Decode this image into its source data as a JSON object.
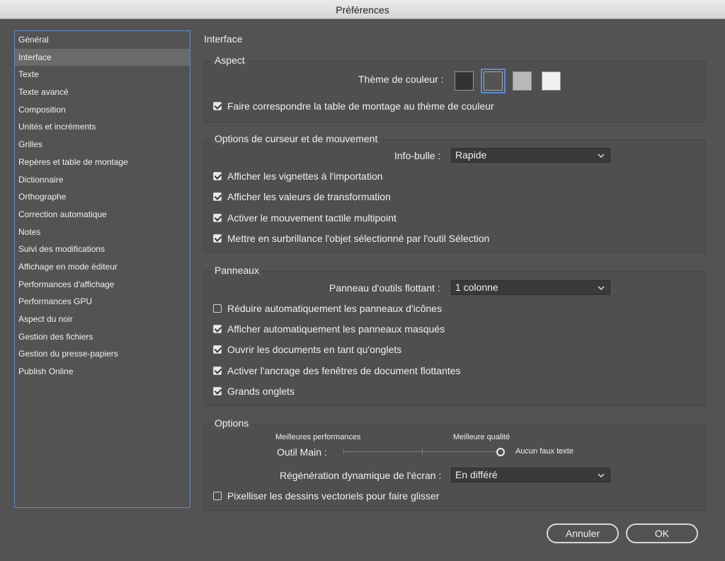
{
  "window": {
    "title": "Préférences"
  },
  "sidebar": {
    "selected_index": 1,
    "items": [
      "Général",
      "Interface",
      "Texte",
      "Texte avancé",
      "Composition",
      "Unités et incréments",
      "Grilles",
      "Repères et table de montage",
      "Dictionnaire",
      "Orthographe",
      "Correction automatique",
      "Notes",
      "Suivi des modifications",
      "Affichage en mode éditeur",
      "Performances d'affichage",
      "Performances GPU",
      "Aspect du noir",
      "Gestion des fichiers",
      "Gestion du presse-papiers",
      "Publish Online"
    ]
  },
  "page": {
    "title": "Interface"
  },
  "aspect": {
    "title": "Aspect",
    "theme_label": "Thème de couleur :",
    "themes": [
      {
        "name": "darkest",
        "color": "#323232",
        "selected": false
      },
      {
        "name": "dark",
        "color": "#535353",
        "selected": true
      },
      {
        "name": "light",
        "color": "#b8b8b8",
        "selected": false
      },
      {
        "name": "lightest",
        "color": "#f0f0f0",
        "selected": false
      }
    ],
    "match_pasteboard": {
      "label": "Faire correspondre la table de montage au thème de couleur",
      "checked": true
    }
  },
  "cursor": {
    "title": "Options de curseur et de mouvement",
    "tooltip_label": "Info-bulle :",
    "tooltip_value": "Rapide",
    "checks": [
      {
        "label": "Afficher les vignettes à l'importation",
        "checked": true
      },
      {
        "label": "Afficher les valeurs de transformation",
        "checked": true
      },
      {
        "label": "Activer le mouvement tactile multipoint",
        "checked": true
      },
      {
        "label": "Mettre en surbrillance l'objet sélectionné par l'outil Sélection",
        "checked": true
      }
    ]
  },
  "panels": {
    "title": "Panneaux",
    "floating_label": "Panneau d'outils flottant :",
    "floating_value": "1 colonne",
    "checks": [
      {
        "label": "Réduire automatiquement les panneaux d'icônes",
        "checked": false
      },
      {
        "label": "Afficher automatiquement les panneaux masqués",
        "checked": true
      },
      {
        "label": "Ouvrir les documents en tant qu'onglets",
        "checked": true
      },
      {
        "label": "Activer l'ancrage des fenêtres de document flottantes",
        "checked": true
      },
      {
        "label": "Grands onglets",
        "checked": true
      }
    ]
  },
  "options": {
    "title": "Options",
    "best_perf": "Meilleures performances",
    "best_quality": "Meilleure qualité",
    "hand_tool_label": "Outil Main :",
    "hand_tool_value_label": "Aucun faux texte",
    "hand_tool_level": 1.0,
    "live_redraw_label": "Régénération dynamique de l'écran :",
    "live_redraw_value": "En différé",
    "rasterize": {
      "label": "Pixelliser les dessins vectoriels pour faire glisser",
      "checked": false
    }
  },
  "buttons": {
    "cancel": "Annuler",
    "ok": "OK"
  }
}
